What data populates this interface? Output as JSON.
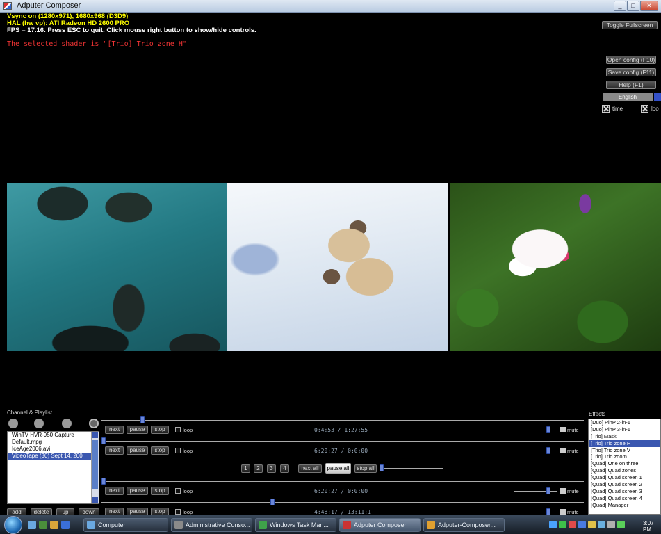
{
  "window": {
    "title": "Adputer Composer",
    "controls": [
      "_",
      "□",
      "✕"
    ]
  },
  "overlay": {
    "line1": "Vsync on (1280x971), 1680x968 (D3D9)",
    "line2": "HAL (hw vp): ATI Radeon HD 2600 PRO",
    "line3": "FPS = 17.16. Press ESC to quit. Click mouse right button to show/hide controls.",
    "shader": "The selected shader is \"[Trio] Trio zone H\""
  },
  "right_controls": {
    "toggle_fullscreen": "Toggle Fullscreen",
    "open_config": "Open config (F10)",
    "save_config": "Save config (F11)",
    "help": "Help (F1)",
    "language": "English",
    "check1_label": "time",
    "check2_label": "loo"
  },
  "channel": {
    "header": "Channel & Playlist",
    "playlist": [
      "WinTV HVR-950 Capture",
      "Default.mpg",
      "IceAge2006.avi",
      "VideoTape (30) Sept 14, 200"
    ],
    "selected_index": 3,
    "buttons": {
      "add": "add",
      "delete": "delete",
      "up": "up",
      "down": "down"
    }
  },
  "players": [
    {
      "next": "next",
      "pause": "pause",
      "stop": "stop",
      "loop": "loop",
      "time": "0:4:53 / 1:27:55",
      "mute": "mute",
      "progress": 0.08,
      "volume": 0.85
    },
    {
      "next": "next",
      "pause": "pause",
      "stop": "stop",
      "loop": "loop",
      "time": "6:20:27 / 0:0:00",
      "mute": "mute",
      "progress": 0.0,
      "volume": 0.85
    },
    {
      "next": "next",
      "pause": "pause",
      "stop": "stop",
      "loop": "loop",
      "time": "6:20:27 / 0:0:00",
      "mute": "mute",
      "progress": 0.0,
      "volume": 0.85
    },
    {
      "next": "next",
      "pause": "pause",
      "stop": "stop",
      "loop": "loop",
      "time": "4:48:17 / 13:11:1",
      "mute": "mute",
      "progress": 0.35,
      "volume": 0.85
    }
  ],
  "global_controls": {
    "b1": "1",
    "b2": "2",
    "b3": "3",
    "b4": "4",
    "next_all": "next all",
    "pause_all": "pause all",
    "stop_all": "stop all"
  },
  "effects": {
    "header": "Effects",
    "items": [
      "[Duo] PinP 2-in-1",
      "[Duo] PinP 3-in-1",
      "[Trio] Mask",
      "[Trio] Trio zone H",
      "[Trio] Trio zone V",
      "[Trio] Trio zoom",
      "[Quad] One on three",
      "[Quad] Quad zones",
      "[Quad] Quad screen 1",
      "[Quad] Quad screen 2",
      "[Quad] Quad screen 3",
      "[Quad] Quad screen 4",
      "[Quad] Manager"
    ],
    "selected_index": 3
  },
  "taskbar": {
    "items": [
      "Computer",
      "Administrative Conso...",
      "Windows Task Man...",
      "Adputer Composer",
      "Adputer-Composer..."
    ],
    "active_index": 3,
    "clock": "3:07 PM"
  }
}
